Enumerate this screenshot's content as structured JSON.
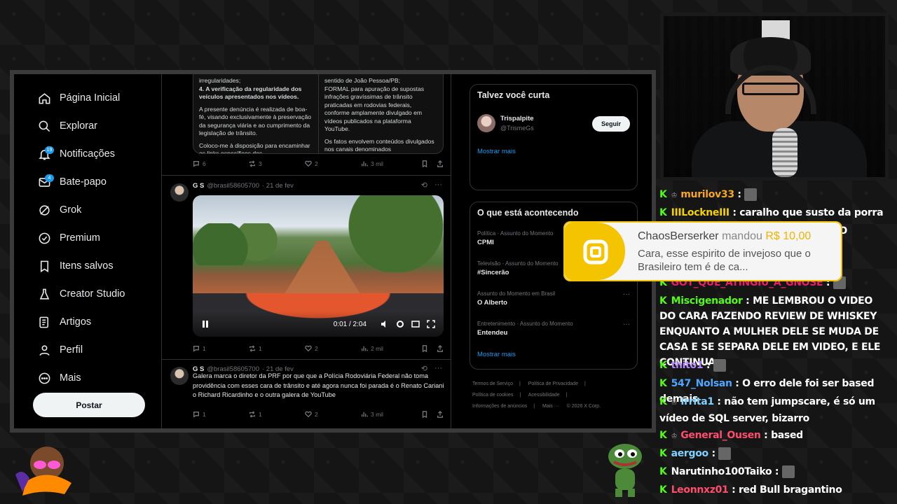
{
  "sidebar": {
    "items": [
      {
        "label": "Página Inicial",
        "icon": "home-icon"
      },
      {
        "label": "Explorar",
        "icon": "search-icon"
      },
      {
        "label": "Notificações",
        "icon": "bell-icon",
        "badge": "19"
      },
      {
        "label": "Bate-papo",
        "icon": "mail-icon",
        "badge": "4"
      },
      {
        "label": "Grok",
        "icon": "grok-icon"
      },
      {
        "label": "Premium",
        "icon": "premium-icon"
      },
      {
        "label": "Itens salvos",
        "icon": "bookmark-icon"
      },
      {
        "label": "Creator Studio",
        "icon": "flask-icon"
      },
      {
        "label": "Artigos",
        "icon": "article-icon"
      },
      {
        "label": "Perfil",
        "icon": "person-icon"
      },
      {
        "label": "Mais",
        "icon": "more-icon"
      }
    ],
    "post_label": "Postar"
  },
  "quote": {
    "left": [
      "irregularidades;",
      "4.   A verificação da regularidade dos veículos apresentados nos vídeos.",
      "A presente denúncia é realizada de boa-fé, visando exclusivamente à preservação da segurança viária e ao cumprimento da legislação de trânsito.",
      "Coloco-me à disposição para encaminhar os links específicos dos"
    ],
    "right": [
      "sentido de João Pessoa/PB;",
      "FORMAL para apuração de supostas infrações gravíssimas de trânsito praticadas em rodovias federais, conforme amplamente divulgado em vídeos publicados na plataforma YouTube.",
      "Os fatos envolvem conteúdos divulgados nos canais denominados"
    ]
  },
  "tweet1_actions": {
    "replies": "6",
    "reposts": "3",
    "likes": "2",
    "views": "3 mil"
  },
  "tweet2": {
    "name": "G S",
    "handle": "@brasil58605700",
    "date": "· 21 de fev",
    "video_time": "0:01 / 2:04",
    "actions": {
      "replies": "1",
      "reposts": "1",
      "likes": "2",
      "views": "2 mil"
    }
  },
  "tweet3": {
    "name": "G S",
    "handle": "@brasil58605700",
    "date": "· 21 de fev",
    "text": "Galera marca o diretor da PRF por que que a Polícia Rodoviária Federal não toma providência com esses cara de trânsito e até agora nunca foi parada é o Renato Cariani o Richard Ricardinho e o outra galera de YouTube",
    "actions": {
      "replies": "1",
      "reposts": "1",
      "likes": "2",
      "views": "3 mil"
    }
  },
  "who_to_follow": {
    "title": "Talvez você curta",
    "user_name": "Trispalpite",
    "user_handle": "@TrismeGs",
    "follow_label": "Seguir",
    "show_more": "Mostrar mais"
  },
  "trends": {
    "title": "O que está acontecendo",
    "items": [
      {
        "meta": "Política · Assunto do Momento",
        "name": "CPMI"
      },
      {
        "meta": "Televisão · Assunto do Momento",
        "name": "#Sincerão"
      },
      {
        "meta": "Assunto do Momento em Brasil",
        "name": "O Alberto"
      },
      {
        "meta": "Entretenimento · Assunto do Momento",
        "name": "Entendeu"
      }
    ],
    "show_more": "Mostrar mais"
  },
  "footer": [
    "Termos de Serviço",
    "|",
    "Política de Privacidade",
    "|",
    "Política de cookies",
    "|",
    "Acessibilidade",
    "|",
    "Informações de anúncios",
    "|",
    "Mais ···",
    "© 2026 X Corp."
  ],
  "donation": {
    "user": "ChaosBerserker",
    "verb": "mandou",
    "amount": "R$ 10,00",
    "message": "Cara, esse espirito de invejoso que o Brasileiro tem é de ca..."
  },
  "chat": [
    {
      "user": "murilov33",
      "color": "#f5a623",
      "text": ""
    },
    {
      "user": "IIILockneIII",
      "color": "#f5d200",
      "text": "caralho que susto da porra"
    },
    {
      "user": "GOT_QUE_ATINGIU_A_GNOSE",
      "color": "#e91e63",
      "text": ""
    },
    {
      "user": "Miscigenador",
      "color": "#53fc18",
      "text": "ME LEMBROU O VIDEO DO CARA FAZENDO REVIEW DE WHISKEY ENQUANTO A MULHER DELE SE MUDA DE CASA E SE SEPARA DELE EM VIDEO, E ELE CONTINUA"
    },
    {
      "user": "thito1",
      "color": "#b388ff",
      "text": ""
    },
    {
      "user": "547_Nolsan",
      "color": "#4da6ff",
      "text": "O erro dele foi ser based demais"
    },
    {
      "user": "Irrita1",
      "color": "#7fd1ff",
      "text": "não tem jumpscare, é só um vídeo de SQL server, bizarro"
    },
    {
      "user": "General_Ousen",
      "color": "#ff4d6d",
      "text": "based"
    },
    {
      "user": "aergoo",
      "color": "#7fd1ff",
      "text": ""
    },
    {
      "user": "Narutinho100Taiko",
      "color": "#ffffff",
      "text": ""
    },
    {
      "user": "Leonnxz01",
      "color": "#ff4d6d",
      "text": "red Bull bragantino"
    }
  ],
  "chat_partial": "M O"
}
